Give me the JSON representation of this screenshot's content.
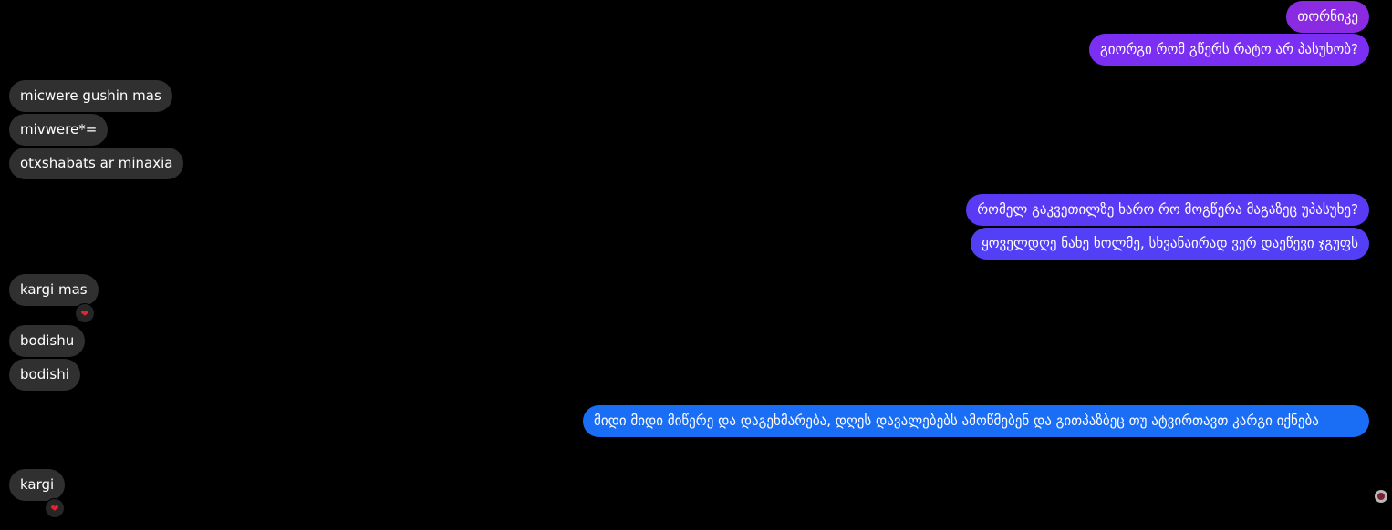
{
  "messages": [
    {
      "side": "out",
      "text": "თორნიკე",
      "color": "#8a2be2"
    },
    {
      "side": "out",
      "text": "გიორგი რომ გწერს რატო არ პასუხობ?",
      "color": "#7b2ff2"
    },
    {
      "side": "in",
      "text": "micwere gushin mas"
    },
    {
      "side": "in",
      "text": "mivwere*="
    },
    {
      "side": "in",
      "text": "otxshabats ar minaxia"
    },
    {
      "side": "out",
      "text": "რომელ გაკვეთილზე ხარო რო მოგწერა მაგაზეც უპასუხე?",
      "color": "#5b3af5"
    },
    {
      "side": "out",
      "text": "ყოველდღე ნახე ხოლმე, სხვანაირად ვერ დაეწევი ჯგუფს",
      "color": "#5340f6"
    },
    {
      "side": "in",
      "text": "kargi mas",
      "reaction": "❤"
    },
    {
      "side": "in",
      "text": "bodishu"
    },
    {
      "side": "in",
      "text": "bodishi"
    },
    {
      "side": "out",
      "text": "მიდი მიდი მიწერე და დაგეხმარება, დღეს დავალებებს ამოწმებენ და გითპაზბეც თუ ატვირთავთ კარგი იქნება",
      "color": "#1a6ef5"
    },
    {
      "side": "in",
      "text": "kargi",
      "reaction": "❤"
    }
  ],
  "seen_indicator": "avatar-seen"
}
